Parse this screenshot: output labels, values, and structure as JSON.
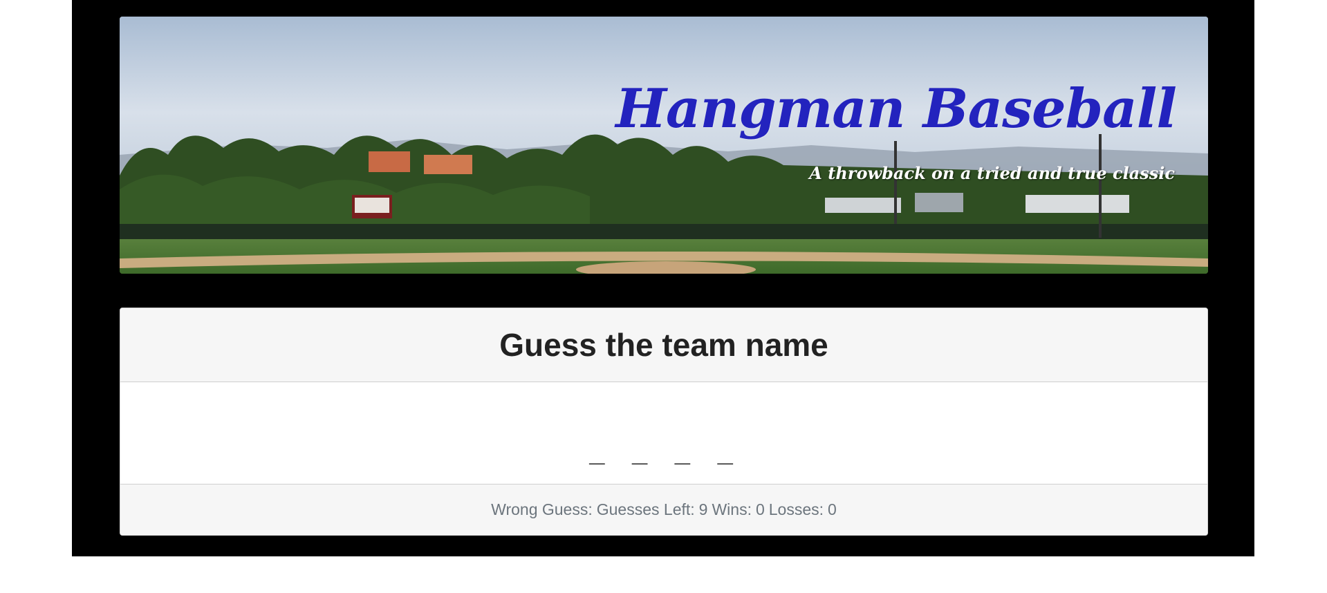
{
  "banner": {
    "title": "Hangman Baseball",
    "subtitle": "A throwback on a tried and true classic"
  },
  "game": {
    "heading": "Guess the team name",
    "word_display": "_ _ _ _",
    "status": {
      "wrong_guess_label": "Wrong Guess:",
      "guesses_left_label": "Guesses Left:",
      "guesses_left": "9",
      "wins_label": "Wins:",
      "wins": "0",
      "losses_label": "Losses:",
      "losses": "0"
    }
  },
  "colors": {
    "title": "#2323be",
    "page_frame": "#000000"
  }
}
